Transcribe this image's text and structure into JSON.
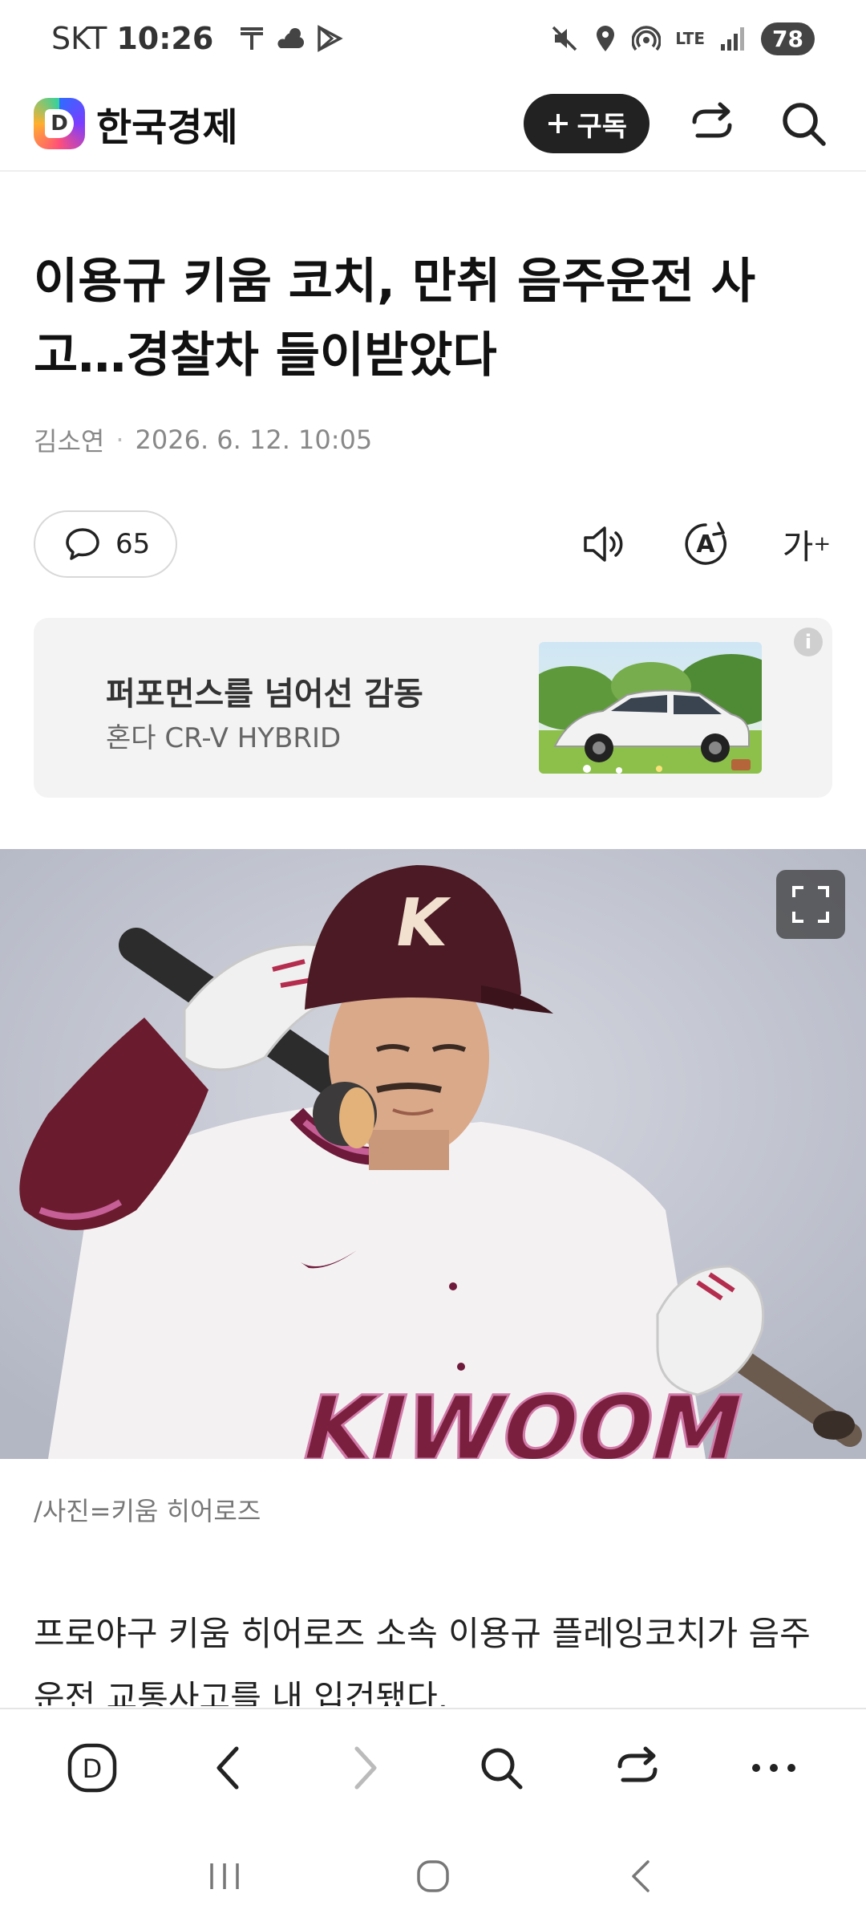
{
  "status_bar": {
    "carrier": "SKT",
    "time": "10:26",
    "network": "LTE",
    "battery": "78"
  },
  "header": {
    "brand_logo_letter": "D",
    "brand_name": "한국경제",
    "subscribe_label": "구독",
    "icons": [
      "share-icon",
      "search-icon"
    ]
  },
  "article": {
    "headline": "이용규 키움 코치, 만취 음주운전 사고…경찰차 들이받았다",
    "author": "김소연",
    "date": "2026. 6. 12. 10:05",
    "comment_count": "65",
    "tool_icons": [
      "speaker-icon",
      "translate-icon",
      "font-size-icon"
    ],
    "font_size_glyph": "가",
    "translate_glyph": "A"
  },
  "ad": {
    "title": "퍼포먼스를 넘어선 감동",
    "subtitle": "혼다 CR-V HYBRID",
    "info_glyph": "i"
  },
  "photo": {
    "helmet_letter": "K",
    "jersey_text": "KIWOOM",
    "caption": "/사진=키움 히어로즈"
  },
  "body": {
    "first_paragraph": "프로야구 키움 히어로즈 소속 이용규 플레잉코치가 음주운전 교통사고를 내 입건됐다."
  },
  "bottom_nav": {
    "home_letter": "D",
    "items": [
      "home-icon",
      "back-icon",
      "forward-icon",
      "search-icon",
      "share-icon",
      "more-icon"
    ]
  },
  "colors": {
    "header_button_bg": "#222222",
    "ad_bg": "#f3f3f3",
    "photo_bg": "#bfc3cf",
    "jersey_accent": "#7a1f3d"
  }
}
